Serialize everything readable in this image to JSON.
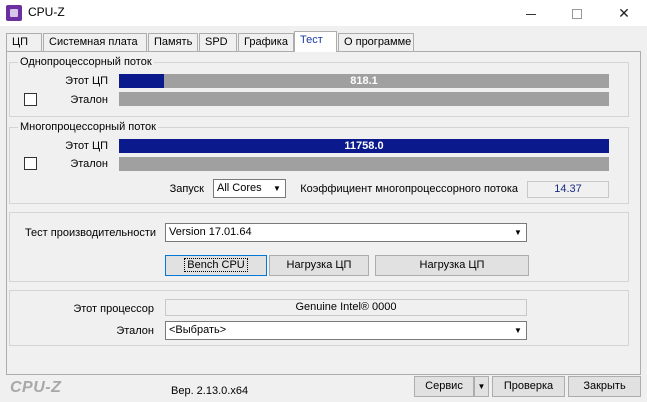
{
  "window": {
    "title": "CPU-Z",
    "minimize": "—",
    "close": "✕"
  },
  "tabs": [
    {
      "label": "ЦП"
    },
    {
      "label": "Системная плата"
    },
    {
      "label": "Память"
    },
    {
      "label": "SPD"
    },
    {
      "label": "Графика"
    },
    {
      "label": "Тест"
    },
    {
      "label": "О программе"
    }
  ],
  "single_thread": {
    "title": "Однопроцессорный поток",
    "this_cpu_label": "Этот ЦП",
    "this_cpu_value": "818.1",
    "this_cpu_fill": 0.091,
    "reference_label": "Эталон",
    "reference_checked": false
  },
  "multi_thread": {
    "title": "Многопроцессорный поток",
    "this_cpu_label": "Этот ЦП",
    "this_cpu_value": "11758.0",
    "this_cpu_fill": 1.0,
    "reference_label": "Эталон",
    "reference_checked": false,
    "threads_label": "Запуск",
    "threads_value": "All Cores",
    "ratio_label": "Коэффициент многопроцессорного потока",
    "ratio_value": "14.37"
  },
  "benchmark": {
    "label": "Тест производительности",
    "version_value": "Version 17.01.64",
    "bench_button": "Bench CPU",
    "stress_button_1": "Нагрузка ЦП",
    "stress_button_2": "Нагрузка ЦП"
  },
  "processor": {
    "this_label": "Этот процессор",
    "this_value": "Genuine Intel® 0000",
    "reference_label": "Эталон",
    "reference_value": "<Выбрать>"
  },
  "footer": {
    "logo": "CPU-Z",
    "version": "Вер. 2.13.0.x64",
    "service_button": "Сервис",
    "validate_button": "Проверка",
    "close_button": "Закрыть"
  },
  "colors": {
    "bar_fill": "#0a1a8c",
    "bar_background": "#a0a0a0",
    "active_tab_text": "#1a3aa0",
    "ratio_text": "#1a2a80"
  }
}
